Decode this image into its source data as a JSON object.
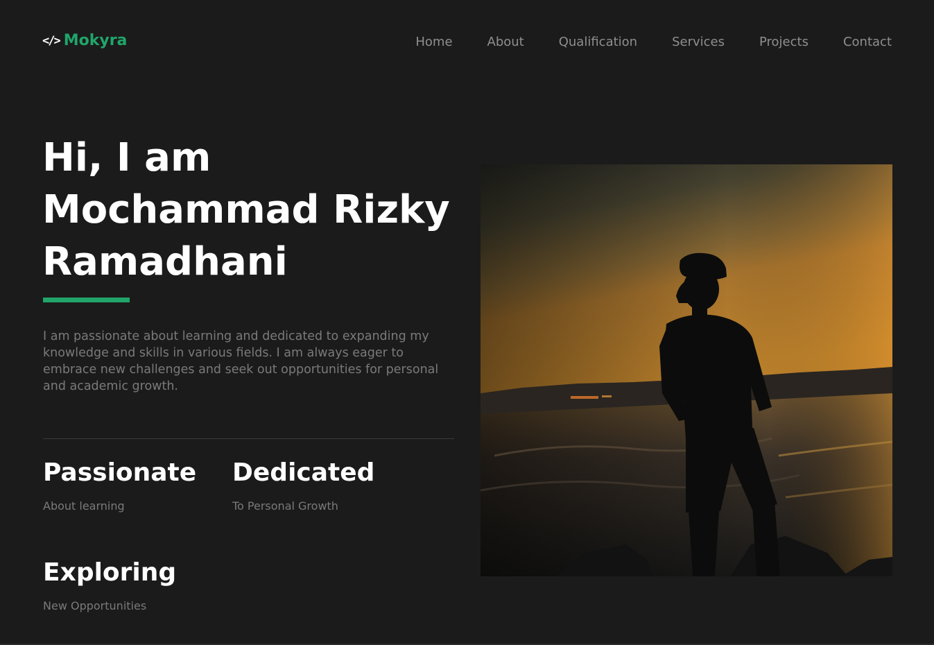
{
  "brand": {
    "icon": "</>",
    "name": "Mokyra",
    "accent_color": "#21a56a"
  },
  "nav": {
    "items": [
      {
        "label": "Home"
      },
      {
        "label": "About"
      },
      {
        "label": "Qualification"
      },
      {
        "label": "Services"
      },
      {
        "label": "Projects"
      },
      {
        "label": "Contact"
      }
    ]
  },
  "hero": {
    "title_line1": "Hi, I am",
    "title_line2": "Mochammad Rizky",
    "title_line3": "Ramadhani",
    "description": "I am passionate about learning and dedicated to expanding my knowledge and skills in various fields. I am always eager to embrace new challenges and seek out opportunities for personal and academic growth."
  },
  "stats": [
    {
      "title": "Passionate",
      "subtitle": "About learning"
    },
    {
      "title": "Dedicated",
      "subtitle": "To Personal Growth"
    },
    {
      "title": "Exploring",
      "subtitle": "New Opportunities"
    }
  ],
  "photo": {
    "icon": "silhouette-beach-sunset-photo"
  },
  "colors": {
    "background": "#1b1b1b",
    "text_primary": "#ffffff",
    "text_muted": "#7a7a7a",
    "nav_text": "#8f8f8f"
  }
}
